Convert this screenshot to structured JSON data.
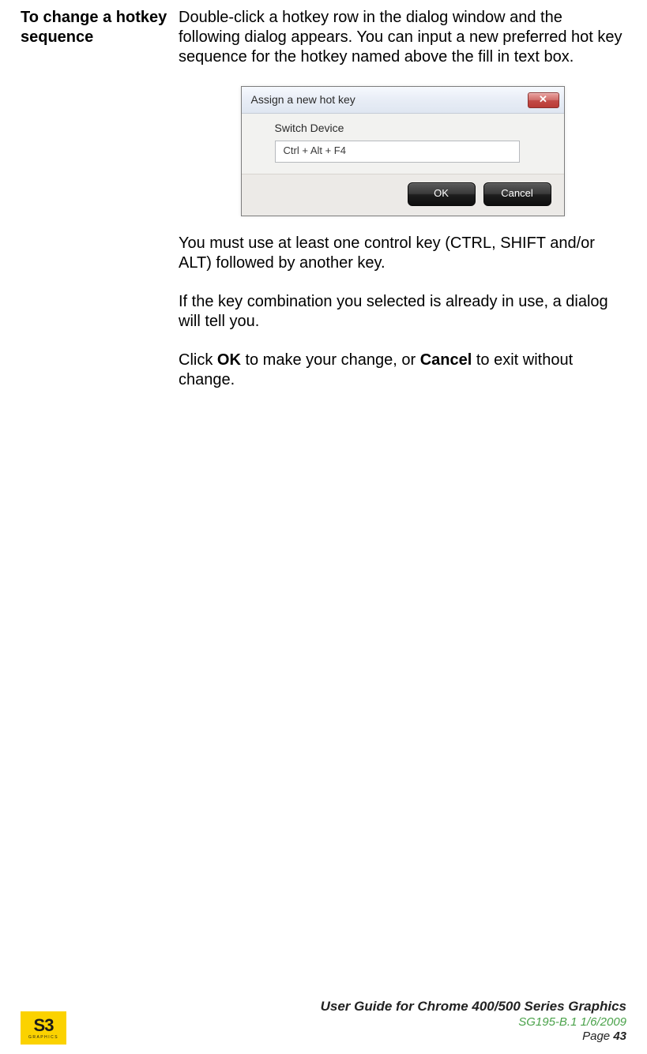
{
  "leftHeading": "To change a hotkey sequence",
  "intro": "Double-click a hotkey row in the dialog window and the following dialog appears. You can input a new preferred hot key sequence for the hotkey named above the fill in text box.",
  "dialog": {
    "title": "Assign a new hot key",
    "closeGlyph": "✕",
    "fieldLabel": "Switch Device",
    "fieldValue": "Ctrl + Alt + F4",
    "okLabel": "OK",
    "cancelLabel": "Cancel"
  },
  "para2": "You must use at least one control key (CTRL, SHIFT and/or ALT) followed by another key.",
  "para3": "If the key combination you selected is already in use, a dialog will tell you.",
  "para4_pre": "Click ",
  "para4_ok": "OK",
  "para4_mid": " to make your change, or ",
  "para4_cancel": "Cancel",
  "para4_post": " to exit without change.",
  "footer": {
    "logoTop": "S3",
    "logoBottom": "GRAPHICS",
    "line1": "User Guide for Chrome 400/500 Series Graphics",
    "line2": "SG195-B.1   1/6/2009",
    "line3_label": "Page ",
    "line3_num": "43"
  }
}
